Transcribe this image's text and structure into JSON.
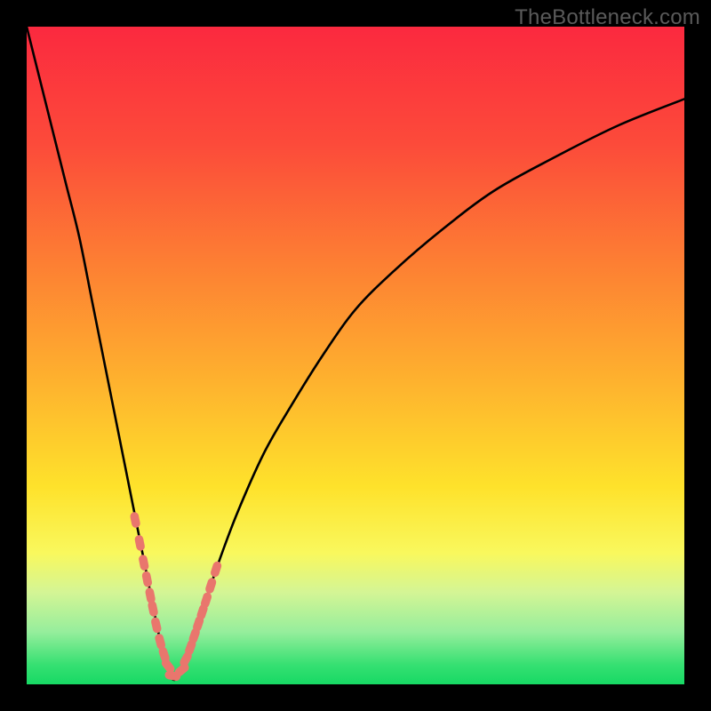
{
  "watermark": "TheBottleneck.com",
  "colors": {
    "frame": "#000000",
    "curve": "#000000",
    "marker": "#e9766d",
    "gradient_stops": [
      {
        "pct": 0,
        "color": "#fb293f"
      },
      {
        "pct": 18,
        "color": "#fc4b3a"
      },
      {
        "pct": 36,
        "color": "#fd7f33"
      },
      {
        "pct": 54,
        "color": "#feb22e"
      },
      {
        "pct": 70,
        "color": "#fee22b"
      },
      {
        "pct": 80,
        "color": "#f9f85d"
      },
      {
        "pct": 86,
        "color": "#d4f595"
      },
      {
        "pct": 92,
        "color": "#96ee9c"
      },
      {
        "pct": 97,
        "color": "#36e072"
      },
      {
        "pct": 100,
        "color": "#17d964"
      }
    ]
  },
  "chart_data": {
    "type": "line",
    "title": "",
    "xlabel": "",
    "ylabel": "",
    "xlim": [
      0,
      100
    ],
    "ylim": [
      0,
      100
    ],
    "note": "V-shaped bottleneck curve; y≈0 is optimal (green), higher y = worse (red). Minimum around x≈22.",
    "series": [
      {
        "name": "bottleneck-curve",
        "x": [
          0,
          2,
          4,
          6,
          8,
          10,
          12,
          14,
          16,
          18,
          19,
          20,
          21,
          22,
          23,
          24,
          25,
          27,
          29,
          32,
          36,
          40,
          45,
          50,
          56,
          63,
          71,
          80,
          90,
          100
        ],
        "y": [
          100,
          92,
          84,
          76,
          68,
          58,
          48,
          38,
          28,
          18,
          13,
          8,
          4,
          1,
          1,
          3,
          6,
          12,
          18,
          26,
          35,
          42,
          50,
          57,
          63,
          69,
          75,
          80,
          85,
          89
        ]
      }
    ],
    "markers": {
      "name": "highlight-points",
      "x": [
        16.5,
        17.2,
        17.8,
        18.3,
        18.8,
        19.2,
        19.7,
        20.3,
        20.9,
        21.5,
        22.2,
        23.6,
        24.2,
        24.9,
        25.5,
        26.1,
        26.7,
        27.3,
        28.0,
        28.8
      ],
      "y": [
        25.0,
        21.5,
        18.5,
        16.0,
        13.5,
        11.5,
        9.0,
        6.5,
        4.5,
        2.8,
        1.3,
        2.2,
        3.8,
        5.6,
        7.4,
        9.2,
        11.0,
        12.8,
        15.0,
        17.5
      ]
    }
  }
}
